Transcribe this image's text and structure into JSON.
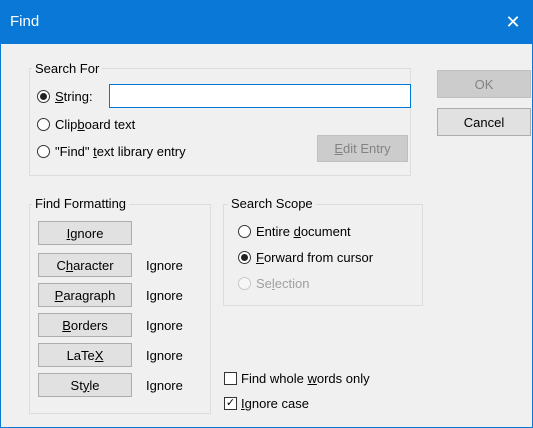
{
  "window": {
    "title": "Find",
    "close_glyph": "✕"
  },
  "search_for": {
    "label": "Search For",
    "string_option": {
      "pre": "",
      "accel": "S",
      "post": "tring:",
      "selected": true
    },
    "string_value": "",
    "clipboard_option": {
      "pre": "Clip",
      "accel": "b",
      "post": "oard text",
      "selected": false
    },
    "library_option": {
      "pre": "\"Find\" ",
      "accel": "t",
      "post": "ext library entry",
      "selected": false
    },
    "edit_entry_button": {
      "pre": "",
      "accel": "E",
      "post": "dit Entry",
      "enabled": false
    }
  },
  "buttons": {
    "ok": {
      "label": "OK",
      "enabled": false
    },
    "cancel": {
      "label": "Cancel",
      "enabled": true
    }
  },
  "find_formatting": {
    "label": "Find Formatting",
    "ignore_button": {
      "pre": "",
      "accel": "I",
      "post": "gnore"
    },
    "rows": [
      {
        "pre": "C",
        "accel": "h",
        "post": "aracter",
        "value": "Ignore"
      },
      {
        "pre": "",
        "accel": "P",
        "post": "aragraph",
        "value": "Ignore"
      },
      {
        "pre": "",
        "accel": "B",
        "post": "orders",
        "value": "Ignore"
      },
      {
        "pre": "LaTe",
        "accel": "X",
        "post": "",
        "value": "Ignore"
      },
      {
        "pre": "St",
        "accel": "y",
        "post": "le",
        "value": "Ignore"
      }
    ]
  },
  "search_scope": {
    "label": "Search Scope",
    "entire": {
      "pre": "Entire ",
      "accel": "d",
      "post": "ocument",
      "selected": false
    },
    "forward": {
      "pre": "",
      "accel": "F",
      "post": "orward from cursor",
      "selected": true
    },
    "selection": {
      "pre": "Se",
      "accel": "l",
      "post": "ection",
      "selected": false,
      "enabled": false
    }
  },
  "options": {
    "whole_words": {
      "pre": "Find whole ",
      "accel": "w",
      "post": "ords only",
      "checked": false
    },
    "ignore_case": {
      "pre": "",
      "accel": "I",
      "post": "gnore case",
      "checked": true,
      "check_glyph": "✓"
    }
  }
}
